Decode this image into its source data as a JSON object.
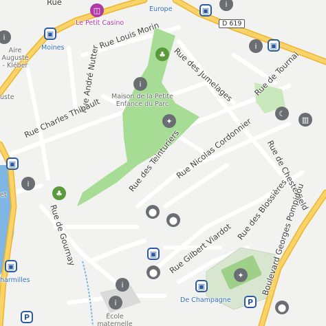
{
  "colors": {
    "land": "#f2f2f0",
    "park": "#a7dc95",
    "park_light": "#c9e9bd",
    "water": "#7fb6e3",
    "major_road": "#f7c948",
    "road": "#ffffff",
    "road_edge": "#dadada"
  },
  "streets": {
    "rue_louis_morin": "Rue Louis Morin",
    "rue_andre_nutter": "Rue André Nutter",
    "rue_charles_thibault": "Rue Charles Thibault",
    "rue_des_teinturiers": "Rue des Teinturiers",
    "rue_nicolas_cordonnier": "Rue Nicolas Cordonnier",
    "rue_des_jumelages": "Rue des Jumelages",
    "rue_de_tournai": "Rue de Tournai",
    "rue_de_chesterfield": "Rue de Chesterfield",
    "rue_des_blossieres": "Rue des Blossières",
    "rue_gilbert_viardot": "Rue Gilbert Viardot",
    "rue_de_gournay": "Rue de Gournay",
    "boulevard_georges_pompidou": "Boulevard Georges Pompidou",
    "rue_top": "Rue"
  },
  "route_shield": "D 619",
  "pois": {
    "le_petit_casino": "Le Petit Casino",
    "maison_petite_enfance": "Maison de la Petite Enfance du Parc",
    "ecole_maternelle": "École maternelle Blossières",
    "aire_auguste": "Aire Auguste - Kléber",
    "uste": "uste",
    "et": "et"
  },
  "stops": {
    "europe": "Europe",
    "moines": "Moines",
    "de_champagne": "De Champagne",
    "charmilles": "harmilles"
  },
  "icons": {
    "tree": "tree-icon",
    "tennis": "tennis-icon",
    "bus": "bus-stop-icon",
    "parking": "parking-icon",
    "mosque": "mosque-icon",
    "museum": "museum-icon",
    "place": "place-pin-icon",
    "info": "info-icon",
    "basket": "basket-icon"
  }
}
